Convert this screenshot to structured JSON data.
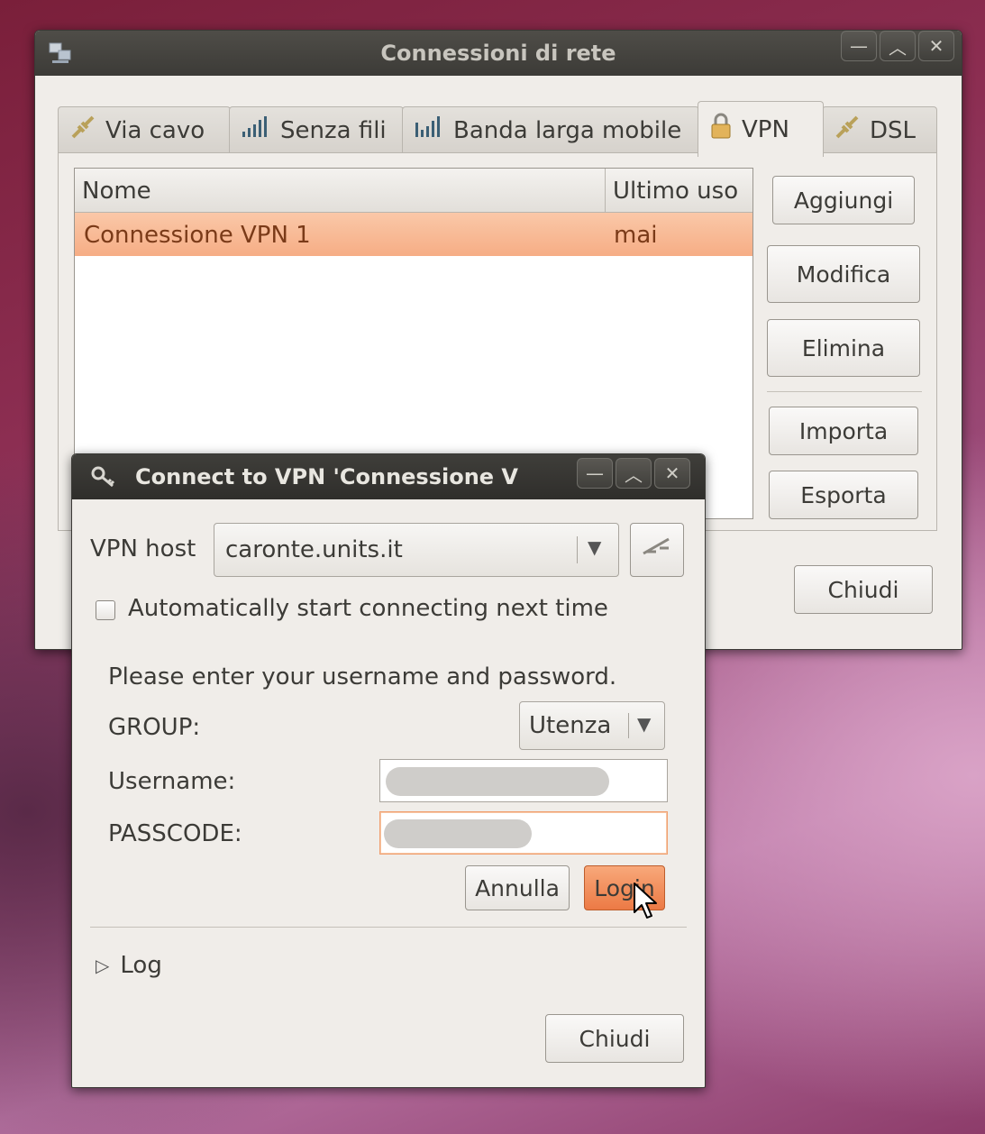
{
  "main_window": {
    "title": "Connessioni di rete",
    "tabs": [
      {
        "label": "Via cavo",
        "icon": "wired-connector-icon"
      },
      {
        "label": "Senza fili",
        "icon": "wireless-signal-icon"
      },
      {
        "label": "Banda larga mobile",
        "icon": "mobile-signal-icon"
      },
      {
        "label": "VPN",
        "icon": "padlock-icon"
      },
      {
        "label": "DSL",
        "icon": "dsl-connector-icon"
      }
    ],
    "active_tab": "VPN",
    "table": {
      "columns": [
        "Nome",
        "Ultimo uso"
      ],
      "rows": [
        {
          "name": "Connessione VPN 1",
          "last_used": "mai",
          "selected": true
        }
      ]
    },
    "buttons": {
      "add": "Aggiungi",
      "edit": "Modifica",
      "delete": "Elimina",
      "import": "Importa",
      "export": "Esporta",
      "close": "Chiudi"
    }
  },
  "vpn_dialog": {
    "title": "Connect to VPN 'Connessione V",
    "vpn_host_label": "VPN host",
    "vpn_host_value": "caronte.units.it",
    "auto_connect_label": "Automatically start connecting next time",
    "auto_connect_checked": false,
    "prompt": "Please enter your username and password.",
    "group_label": "GROUP:",
    "group_value": "Utenza",
    "username_label": "Username:",
    "passcode_label": "PASSCODE:",
    "cancel_button": "Annulla",
    "login_button": "Login",
    "log_label": "Log",
    "close_button": "Chiudi"
  },
  "colors": {
    "selection": "#f8b48e",
    "titlebar": "#3c3b37",
    "accent": "#f07746",
    "window_bg": "#f0ede9"
  }
}
